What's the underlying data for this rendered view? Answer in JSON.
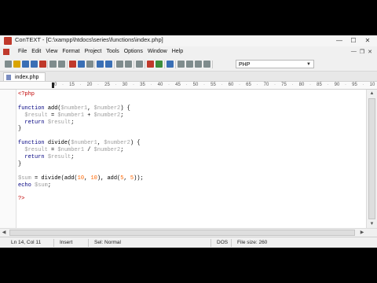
{
  "window": {
    "title": "ConTEXT - [C:\\xampp\\htdocs\\series\\functions\\index.php]",
    "buttons": [
      "—",
      "☐",
      "✕"
    ]
  },
  "menubar": {
    "items": [
      "File",
      "Edit",
      "View",
      "Format",
      "Project",
      "Tools",
      "Options",
      "Window",
      "Help"
    ],
    "mdi_buttons": [
      "—",
      "❐",
      "✕"
    ]
  },
  "toolbar": {
    "language": "PHP",
    "icons": [
      "new-file-icon",
      "open-icon",
      "save-icon",
      "save-all-icon",
      "close-icon",
      "print-icon",
      "print-preview-icon",
      "cut-icon",
      "copy-icon",
      "paste-icon",
      "undo-icon",
      "redo-icon",
      "find-icon",
      "replace-icon",
      "word-wrap-icon",
      "macro-record-icon",
      "macro-play-icon",
      "bookmark-icon",
      "user-exec-1-icon",
      "user-exec-2-icon",
      "user-exec-3-icon",
      "user-exec-4-icon"
    ],
    "colors": {
      "red": "#c0392b",
      "blue": "#3a6fb5",
      "green": "#3c8d3c",
      "gray": "#7f8c8d",
      "yellow": "#d9a400"
    }
  },
  "tabs": [
    {
      "label": "index.php"
    }
  ],
  "ruler": {
    "labels": [
      "10",
      "15",
      "20",
      "25",
      "30",
      "35",
      "40",
      "45",
      "50",
      "55",
      "60",
      "65",
      "70",
      "75",
      "80",
      "85",
      "90",
      "95",
      "10"
    ]
  },
  "editor": {
    "lines": [
      [
        {
          "t": "<?php",
          "c": "php"
        }
      ],
      [],
      [
        {
          "t": "function ",
          "c": "kw"
        },
        {
          "t": "add(",
          "c": "fn"
        },
        {
          "t": "$number1",
          "c": "var"
        },
        {
          "t": ", ",
          "c": "op"
        },
        {
          "t": "$number2",
          "c": "var"
        },
        {
          "t": ") {",
          "c": "op"
        }
      ],
      [
        {
          "t": "  $result",
          "c": "var"
        },
        {
          "t": " = ",
          "c": "op"
        },
        {
          "t": "$number1",
          "c": "var"
        },
        {
          "t": " + ",
          "c": "op"
        },
        {
          "t": "$number2",
          "c": "var"
        },
        {
          "t": ";",
          "c": "op"
        }
      ],
      [
        {
          "t": "  return ",
          "c": "kw"
        },
        {
          "t": "$result",
          "c": "var"
        },
        {
          "t": ";",
          "c": "op"
        }
      ],
      [
        {
          "t": "}",
          "c": "op"
        }
      ],
      [],
      [
        {
          "t": "function ",
          "c": "kw"
        },
        {
          "t": "divide(",
          "c": "fn"
        },
        {
          "t": "$number1",
          "c": "var"
        },
        {
          "t": ", ",
          "c": "op"
        },
        {
          "t": "$number2",
          "c": "var"
        },
        {
          "t": ") {",
          "c": "op"
        }
      ],
      [
        {
          "t": "  $result",
          "c": "var"
        },
        {
          "t": " = ",
          "c": "op"
        },
        {
          "t": "$number1",
          "c": "var"
        },
        {
          "t": " / ",
          "c": "op"
        },
        {
          "t": "$number2",
          "c": "var"
        },
        {
          "t": ";",
          "c": "op"
        }
      ],
      [
        {
          "t": "  return ",
          "c": "kw"
        },
        {
          "t": "$result",
          "c": "var"
        },
        {
          "t": ";",
          "c": "op"
        }
      ],
      [
        {
          "t": "}",
          "c": "op"
        }
      ],
      [],
      [
        {
          "t": "$sum",
          "c": "var"
        },
        {
          "t": " = divide(add(",
          "c": "op"
        },
        {
          "t": "10",
          "c": "num"
        },
        {
          "t": ", ",
          "c": "op"
        },
        {
          "t": "10",
          "c": "num"
        },
        {
          "t": "), add(",
          "c": "op"
        },
        {
          "t": "5",
          "c": "num"
        },
        {
          "t": ", ",
          "c": "op"
        },
        {
          "t": "5",
          "c": "num"
        },
        {
          "t": "));",
          "c": "op"
        }
      ],
      [
        {
          "t": "echo ",
          "c": "kw"
        },
        {
          "t": "$sum",
          "c": "var"
        },
        {
          "t": ";",
          "c": "op"
        }
      ],
      [],
      [
        {
          "t": "?>",
          "c": "php"
        }
      ]
    ]
  },
  "status": {
    "position": "Ln 14, Col 11",
    "mode": "Insert",
    "selection": "Sel: Normal",
    "format": "DOS",
    "filesize": "File size: 260"
  }
}
